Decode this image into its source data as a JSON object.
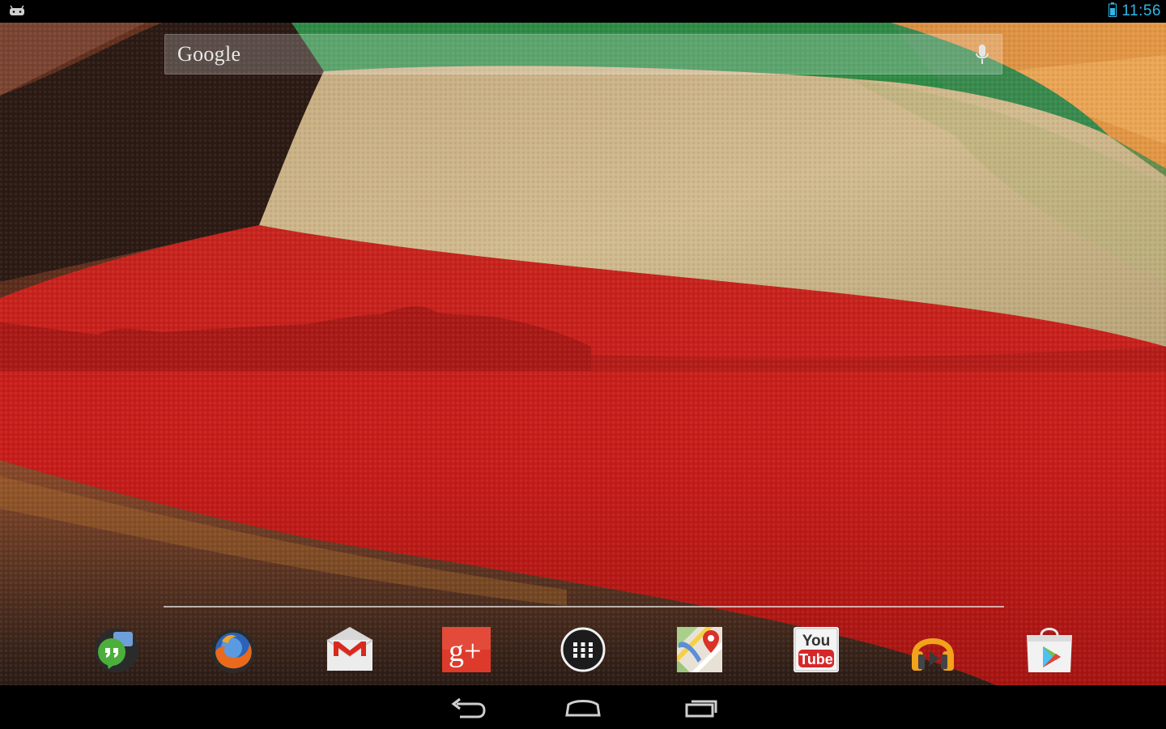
{
  "status_bar": {
    "clock": "11:56",
    "notification_icon": "android-debug-icon",
    "battery_icon": "battery-icon",
    "accent_color": "#33b5e5"
  },
  "search": {
    "label": "Google",
    "mic_icon": "mic-icon"
  },
  "wallpaper": {
    "description_icon": "waving-flag-wallpaper",
    "colors": {
      "green": "#2e8b45",
      "white": "#c9b48a",
      "red": "#c8201e",
      "sky": "#d9853a"
    }
  },
  "dock": {
    "apps": [
      {
        "name": "hangouts-icon"
      },
      {
        "name": "firefox-icon"
      },
      {
        "name": "gmail-icon"
      },
      {
        "name": "google-plus-icon",
        "label": "g+"
      },
      {
        "name": "app-drawer-icon"
      },
      {
        "name": "maps-icon"
      },
      {
        "name": "youtube-icon",
        "label_top": "You",
        "label_bottom": "Tube"
      },
      {
        "name": "play-music-icon"
      },
      {
        "name": "play-store-icon"
      }
    ]
  },
  "nav": {
    "back": "back-icon",
    "home": "home-icon",
    "recents": "recents-icon"
  }
}
